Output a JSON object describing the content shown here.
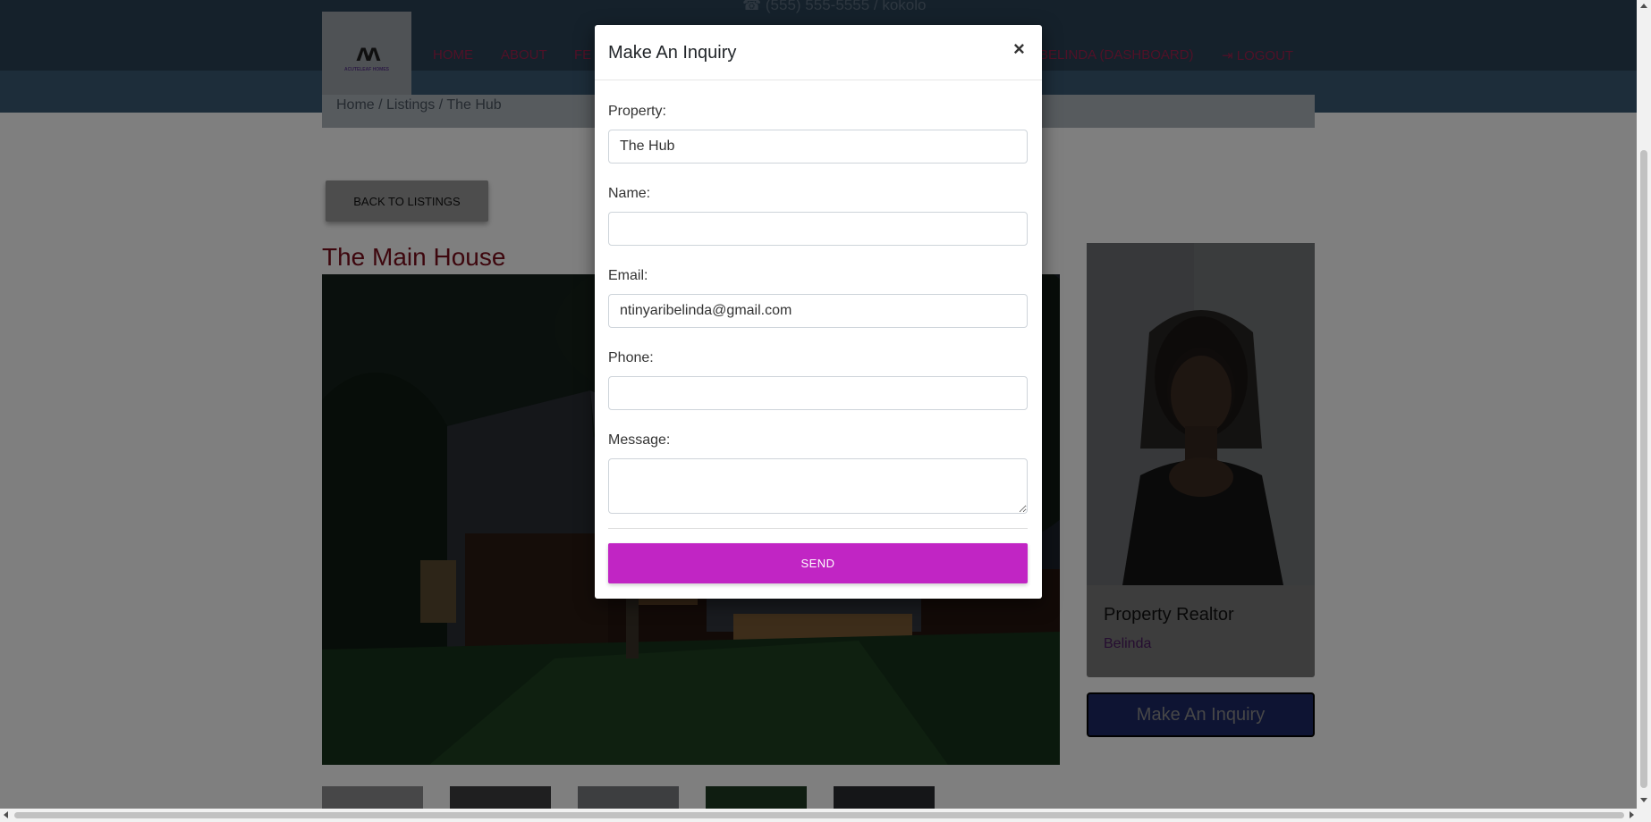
{
  "header": {
    "topbar_info": "☎ (555) 555-5555 / kokolo",
    "logo_text": "ACUTELEAF HOMES",
    "nav": [
      {
        "label": "HOME"
      },
      {
        "label": "ABOUT"
      },
      {
        "label": "FE"
      },
      {
        "label": "BELINDA (DASHBOARD)"
      },
      {
        "label": "LOGOUT"
      }
    ]
  },
  "breadcrumb": "Home  /  Listings  /  The Hub",
  "page": {
    "back_label": "BACK TO LISTINGS",
    "property_title": "The Main House"
  },
  "realtor": {
    "role": "Property Realtor",
    "name": "Belinda",
    "inquiry_button": "Make An Inquiry"
  },
  "modal": {
    "title": "Make An Inquiry",
    "close_symbol": "×",
    "fields": {
      "property": {
        "label": "Property:",
        "value": "The Hub"
      },
      "name": {
        "label": "Name:",
        "value": ""
      },
      "email": {
        "label": "Email:",
        "value": "ntinyaribelinda@gmail.com"
      },
      "phone": {
        "label": "Phone:",
        "value": ""
      },
      "message": {
        "label": "Message:",
        "value": ""
      }
    },
    "send_label": "SEND"
  },
  "colors": {
    "nav_bg": "#2b4356",
    "send_button": "#c125c4",
    "inquiry_button": "#3b52d6",
    "title_red": "#c8182e"
  }
}
